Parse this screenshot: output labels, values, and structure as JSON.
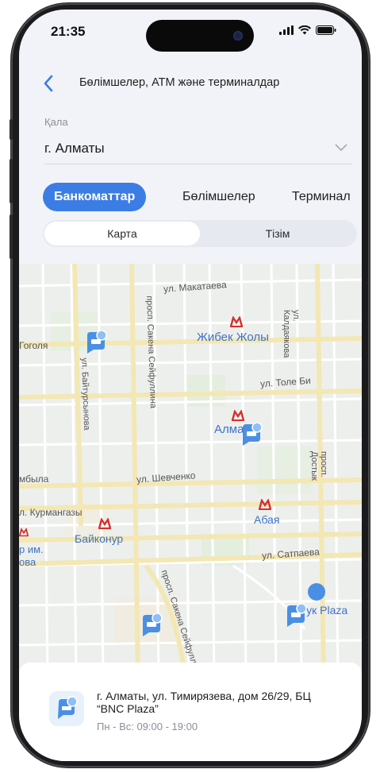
{
  "status": {
    "time": "21:35"
  },
  "header": {
    "title": "Бөлімшелер, АТМ және терминалдар"
  },
  "city": {
    "label": "Қала",
    "value": "г. Алматы"
  },
  "tabs": [
    {
      "label": "Банкоматтар",
      "active": true
    },
    {
      "label": "Бөлімшелер",
      "active": false
    },
    {
      "label": "Терминал",
      "active": false
    }
  ],
  "view_toggle": {
    "map_label": "Карта",
    "list_label": "Тізім",
    "selected": "Карта"
  },
  "map": {
    "streets": [
      "ул. Макатаева",
      "ул. Калдаякова",
      "Гоголя",
      "ул. Байтурсынова",
      "просп. Сакена Сейфуллина",
      "ул. Толе Би",
      "мбыла",
      "ул. Шевченко",
      "л. Курмангазы",
      "ул. Сатпаева",
      "просп. Достык",
      "просп. Сакена Сейфуллина"
    ],
    "metro_stations": [
      "Жибек Жолы",
      "Алматы",
      "Абая",
      "Байконур"
    ],
    "places": [
      "р им.",
      "ова",
      "ятук Plaza"
    ]
  },
  "card": {
    "address": "г. Алматы, ул. Тимирязева, дом 26/29, БЦ “BNC Plaza”",
    "hours": "Пн - Вс: 09:00 - 19:00"
  },
  "colors": {
    "accent": "#3b7de4",
    "metro": "#d5302b",
    "atm_pin": "#4a8fe4"
  }
}
